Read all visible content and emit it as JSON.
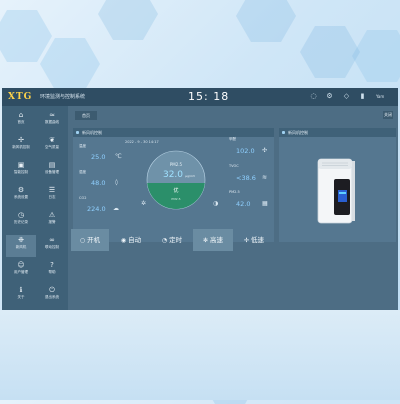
{
  "header": {
    "logo": "XTG",
    "title": "环境监测与控制系统",
    "clock": "15: 18",
    "user": "Yam",
    "icons": [
      "bulb-icon",
      "gear-icon",
      "shield-icon",
      "trash-icon"
    ]
  },
  "sidebar": {
    "items": [
      {
        "label": "首页",
        "icon": "home-icon",
        "glyph": "⌂"
      },
      {
        "label": "数据曲线",
        "icon": "chart-icon",
        "glyph": "≈"
      },
      {
        "label": "新风机控制",
        "icon": "fan-icon",
        "glyph": "✢"
      },
      {
        "label": "空气质量",
        "icon": "leaf-icon",
        "glyph": "❦"
      },
      {
        "label": "智能控制",
        "icon": "chip-icon",
        "glyph": "▣"
      },
      {
        "label": "设备管理",
        "icon": "device-icon",
        "glyph": "▤"
      },
      {
        "label": "系统设置",
        "icon": "settings-icon",
        "glyph": "⚙"
      },
      {
        "label": "日志",
        "icon": "log-icon",
        "glyph": "☰"
      },
      {
        "label": "历史记录",
        "icon": "history-icon",
        "glyph": "◷"
      },
      {
        "label": "报警",
        "icon": "alarm-icon",
        "glyph": "⚠"
      },
      {
        "label": "新风机",
        "icon": "airflow-icon",
        "glyph": "❉"
      },
      {
        "label": "联动控制",
        "icon": "link-icon",
        "glyph": "∞"
      },
      {
        "label": "用户管理",
        "icon": "users-icon",
        "glyph": "☺"
      },
      {
        "label": "帮助",
        "icon": "help-icon",
        "glyph": "?"
      },
      {
        "label": "关于",
        "icon": "info-icon",
        "glyph": "ℹ"
      },
      {
        "label": "退出系统",
        "icon": "exit-icon",
        "glyph": "⏻"
      }
    ],
    "active_index": 10
  },
  "tabs": {
    "home": "首页",
    "close": "关闭"
  },
  "main_panel": {
    "title": "新风机控制",
    "datetime": "2022 - 9 - 30 14:17",
    "left": [
      {
        "label": "温度",
        "value": "25.0",
        "unit": "°C",
        "icon": "thermometer-icon",
        "glyph": "℃"
      },
      {
        "label": "湿度",
        "value": "48.0",
        "unit": "%",
        "icon": "droplet-icon",
        "glyph": "◊"
      },
      {
        "label": "CO2",
        "value": "224.0",
        "unit": "ppm",
        "icon": "co2-icon",
        "glyph": "☁"
      }
    ],
    "right": [
      {
        "label": "甲醛",
        "value": "102.0",
        "unit": "μg",
        "icon": "formaldehyde-icon",
        "glyph": "✣"
      },
      {
        "label": "TVOC",
        "value": "<38.6",
        "unit": "",
        "icon": "tvoc-icon",
        "glyph": "≋"
      },
      {
        "label": "PM2.5",
        "value": "42.0",
        "unit": "",
        "icon": "pm-icon",
        "glyph": "▦"
      }
    ],
    "gauge": {
      "label": "PM2.5",
      "value": "32.0",
      "unit": "μg/m3",
      "grade": "优",
      "grade_label": "PM2.5",
      "fill_fraction": 0.45,
      "fill_color": "#2b8f6a"
    }
  },
  "device_panel": {
    "title": "新风机控制"
  },
  "controls": [
    {
      "label": "开机",
      "icon": "power-icon",
      "glyph": "○",
      "selected": true
    },
    {
      "label": "自动",
      "icon": "auto-icon",
      "glyph": "◉",
      "selected": false
    },
    {
      "label": "定时",
      "icon": "timer-icon",
      "glyph": "◔",
      "selected": false
    },
    {
      "label": "高速",
      "icon": "fan-high-icon",
      "glyph": "✻",
      "selected": true
    },
    {
      "label": "低速",
      "icon": "fan-low-icon",
      "glyph": "✢",
      "selected": false
    }
  ],
  "colors": {
    "accent_value": "#8fd0ff",
    "panel": "#557790",
    "sidebar": "#3f6178"
  }
}
